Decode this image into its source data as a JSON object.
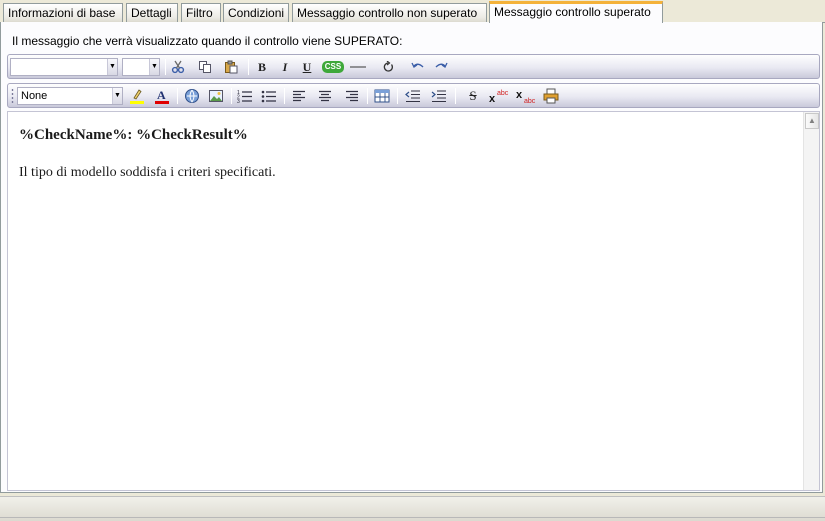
{
  "tabs": [
    {
      "label": "Informazioni di base"
    },
    {
      "label": "Dettagli"
    },
    {
      "label": "Filtro"
    },
    {
      "label": "Condizioni"
    },
    {
      "label": "Messaggio controllo non superato"
    },
    {
      "label": "Messaggio controllo superato",
      "active": true
    }
  ],
  "panel": {
    "caption": "Il messaggio che verrà visualizzato quando il controllo viene SUPERATO:"
  },
  "toolbar1": {
    "font_combo": "",
    "size_combo": "",
    "buttons": [
      "cut-icon",
      "copy-icon",
      "paste-icon",
      "bold-icon",
      "italic-icon",
      "underline-icon",
      "css-icon",
      "horizontal-rule-icon",
      "refresh-icon",
      "undo-icon",
      "redo-icon"
    ],
    "css_label": "CSS"
  },
  "toolbar2": {
    "style_combo": "None",
    "buttons": [
      "highlight-icon",
      "font-color-icon",
      "insert-link-icon",
      "insert-image-icon",
      "numbered-list-icon",
      "bullet-list-icon",
      "align-left-icon",
      "align-center-icon",
      "align-right-icon",
      "insert-table-icon",
      "outdent-icon",
      "indent-icon",
      "strikethrough-icon",
      "superscript-icon",
      "subscript-icon",
      "print-icon"
    ]
  },
  "editor": {
    "heading": "%CheckName%: %CheckResult%",
    "paragraph": "Il tipo di modello soddisfa i criteri specificati."
  },
  "colors": {
    "active_tab_accent": "#f4b23a",
    "toolbar_gradient_bottom": "#c9c9da",
    "highlight_yellow": "#ffff00",
    "font_color_red": "#e00000",
    "css_badge_green": "#3ea83a"
  }
}
